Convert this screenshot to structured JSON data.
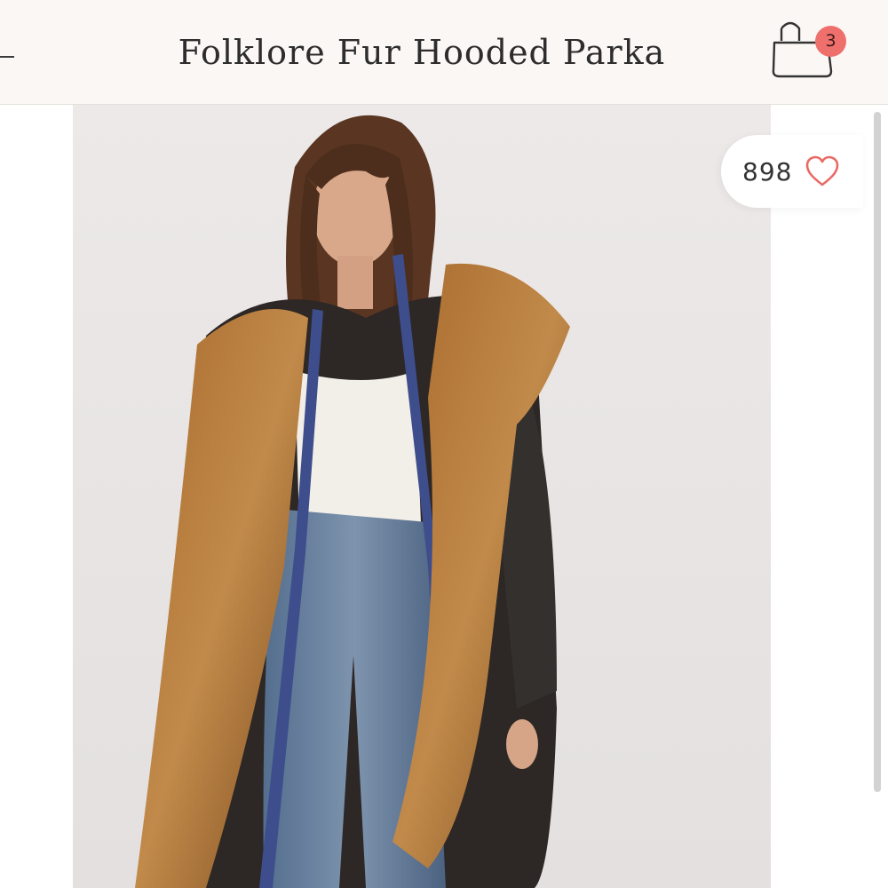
{
  "header": {
    "title": "Folklore Fur Hooded Parka",
    "cart_count": "3"
  },
  "product": {
    "like_count": "898"
  },
  "icons": {
    "back": "back-arrow-icon",
    "cart": "shopping-bag-icon",
    "like": "heart-icon"
  },
  "colors": {
    "header_bg": "#fbf7f4",
    "badge": "#ef6f6c",
    "heart": "#e86a66"
  }
}
